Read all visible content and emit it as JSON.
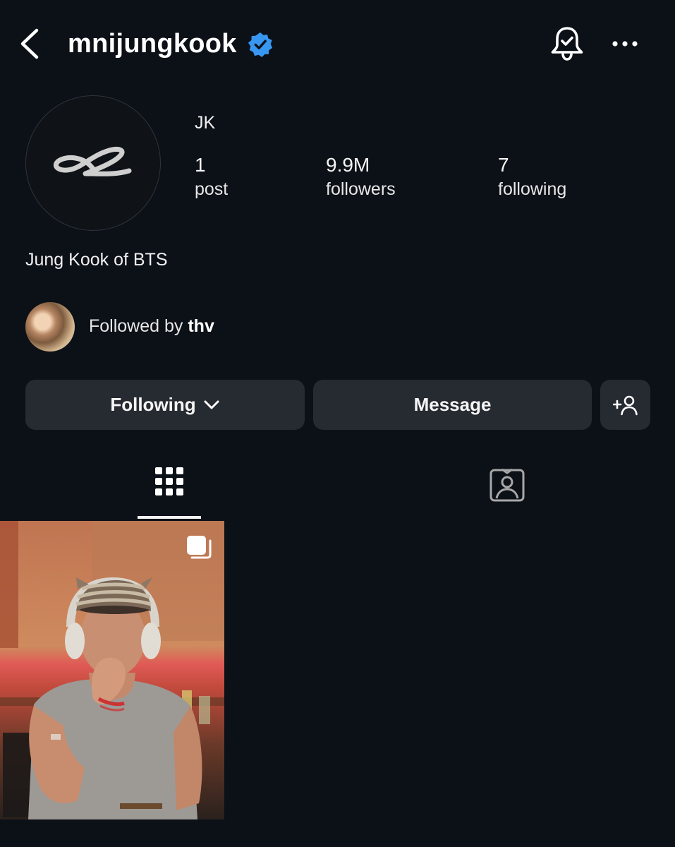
{
  "header": {
    "username": "mnijungkook",
    "verified": true
  },
  "profile": {
    "display_name": "JK",
    "bio": "Jung Kook of BTS",
    "stats": {
      "posts": {
        "value": "1",
        "label": "post"
      },
      "followers": {
        "value": "9.9M",
        "label": "followers"
      },
      "following": {
        "value": "7",
        "label": "following"
      }
    },
    "followed_by": {
      "prefix": "Followed by ",
      "user": "thv"
    }
  },
  "actions": {
    "following_label": "Following",
    "message_label": "Message"
  },
  "tabs": [
    {
      "icon": "grid-icon",
      "active": true
    },
    {
      "icon": "tagged-icon",
      "active": false
    }
  ],
  "colors": {
    "background": "#0c1017",
    "button": "#262a31",
    "verified_badge": "#3897f0",
    "text": "#f5f5f5"
  },
  "icons": [
    "back-icon",
    "verified-icon",
    "bell-icon",
    "more-icon",
    "chevron-down-icon",
    "add-person-icon",
    "grid-icon",
    "tagged-icon",
    "multi-post-icon"
  ]
}
